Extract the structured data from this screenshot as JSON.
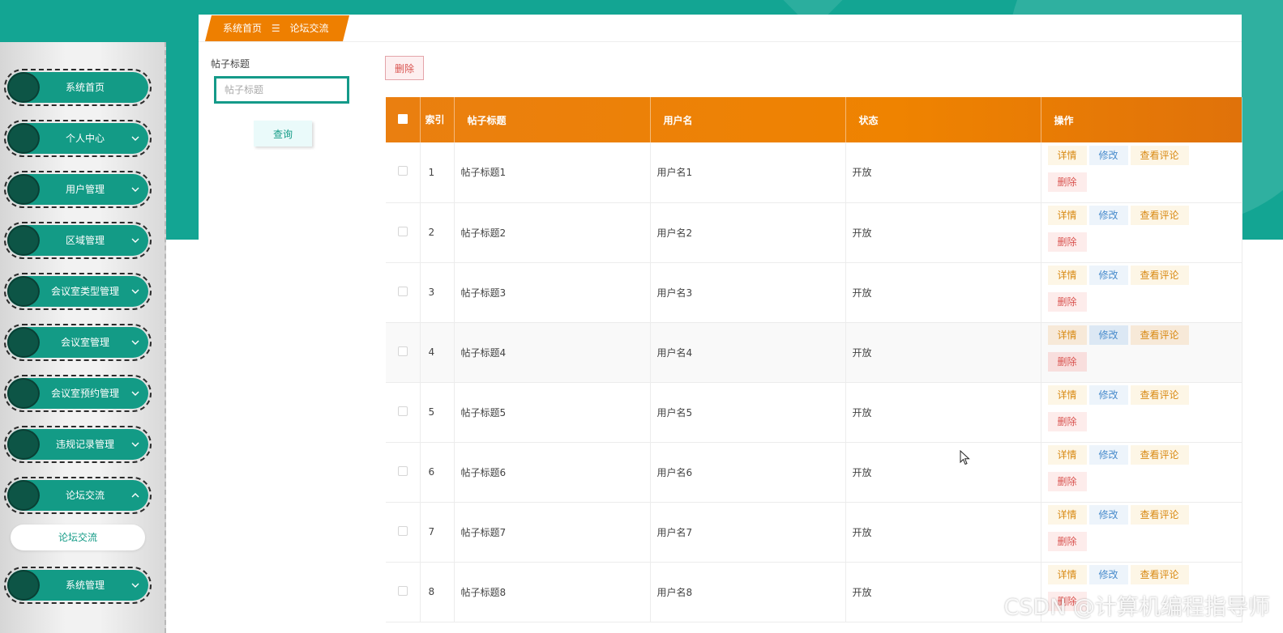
{
  "sidebar": {
    "items": [
      {
        "label": "系统首页",
        "chevron": ""
      },
      {
        "label": "个人中心",
        "chevron": "down"
      },
      {
        "label": "用户管理",
        "chevron": "down"
      },
      {
        "label": "区域管理",
        "chevron": "down"
      },
      {
        "label": "会议室类型管理",
        "chevron": "down"
      },
      {
        "label": "会议室管理",
        "chevron": "down"
      },
      {
        "label": "会议室预约管理",
        "chevron": "down"
      },
      {
        "label": "违规记录管理",
        "chevron": "down"
      },
      {
        "label": "论坛交流",
        "chevron": "up"
      },
      {
        "label": "系统管理",
        "chevron": "down"
      }
    ],
    "submenu": {
      "label": "论坛交流"
    }
  },
  "breadcrumb": {
    "home": "系统首页",
    "separator": "☰",
    "current": "论坛交流"
  },
  "search": {
    "label": "帖子标题",
    "placeholder": "帖子标题",
    "value": "",
    "query_button": "查询"
  },
  "toolbar": {
    "delete_label": "删除"
  },
  "table": {
    "headers": {
      "index": "索引",
      "title": "帖子标题",
      "username": "用户名",
      "status": "状态",
      "actions": "操作"
    },
    "rows": [
      {
        "index": "1",
        "title": "帖子标题1",
        "username": "用户名1",
        "status": "开放"
      },
      {
        "index": "2",
        "title": "帖子标题2",
        "username": "用户名2",
        "status": "开放"
      },
      {
        "index": "3",
        "title": "帖子标题3",
        "username": "用户名3",
        "status": "开放"
      },
      {
        "index": "4",
        "title": "帖子标题4",
        "username": "用户名4",
        "status": "开放"
      },
      {
        "index": "5",
        "title": "帖子标题5",
        "username": "用户名5",
        "status": "开放"
      },
      {
        "index": "6",
        "title": "帖子标题6",
        "username": "用户名6",
        "status": "开放"
      },
      {
        "index": "7",
        "title": "帖子标题7",
        "username": "用户名7",
        "status": "开放"
      },
      {
        "index": "8",
        "title": "帖子标题8",
        "username": "用户名8",
        "status": "开放"
      }
    ],
    "actions": {
      "detail": "详情",
      "edit": "修改",
      "comments": "查看评论",
      "delete": "删除"
    }
  },
  "watermark": "CSDN @计算机编程指导师",
  "colors": {
    "teal": "#13a593",
    "orange": "#ee7f00",
    "dark_green": "#0d5546"
  }
}
